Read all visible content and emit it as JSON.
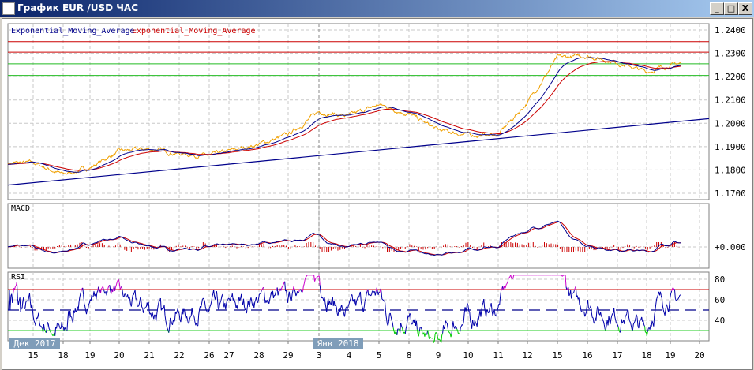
{
  "window": {
    "title": "График EUR /USD ЧАС",
    "min": "_",
    "max": "□",
    "close": "X"
  },
  "legend": [
    {
      "text": "Exponential_Moving_Average",
      "color": "#00008b"
    },
    {
      "text": "Exponential_Moving_Average",
      "color": "#cc0000"
    }
  ],
  "chart_data": {
    "type": "line",
    "title": "EUR/USD hourly",
    "x": [
      "15",
      "18",
      "19",
      "20",
      "21",
      "22",
      "26",
      "27",
      "28",
      "29",
      "3",
      "4",
      "5",
      "8",
      "9",
      "10",
      "11",
      "12",
      "15",
      "16",
      "17",
      "18",
      "19",
      "20"
    ],
    "period_labels": [
      "Дек 2017",
      "Янв 2018"
    ],
    "price": {
      "ylim": [
        1.17,
        1.24
      ],
      "ticks": [
        "1.2400",
        "1.2300",
        "1.2200",
        "1.2100",
        "1.2000",
        "1.1900",
        "1.1800",
        "1.1700"
      ],
      "close": [
        1.183,
        1.178,
        1.181,
        1.188,
        1.189,
        1.187,
        1.186,
        1.188,
        1.191,
        1.195,
        1.205,
        1.203,
        1.208,
        1.204,
        1.197,
        1.195,
        1.195,
        1.209,
        1.228,
        1.229,
        1.226,
        1.222,
        1.225,
        1.227
      ],
      "hlines": [
        {
          "v": 1.235,
          "color": "#cc0000"
        },
        {
          "v": 1.2305,
          "color": "#cc0000"
        },
        {
          "v": 1.2255,
          "color": "#22bb22"
        },
        {
          "v": 1.2205,
          "color": "#22bb22"
        }
      ],
      "trendline": [
        1.1735,
        1.202
      ]
    },
    "macd": {
      "label": "MACD",
      "tick": "+0.000"
    },
    "rsi": {
      "label": "RSI",
      "ticks": [
        "80",
        "60",
        "40"
      ],
      "levels": [
        70,
        50,
        30
      ]
    },
    "colors": {
      "price": "#f0a000",
      "ema_fast": "#00008b",
      "ema_slow": "#cc0000",
      "rsi": "#0000aa",
      "rsi_ob": "#cc00cc",
      "rsi_os": "#00cc00"
    }
  }
}
